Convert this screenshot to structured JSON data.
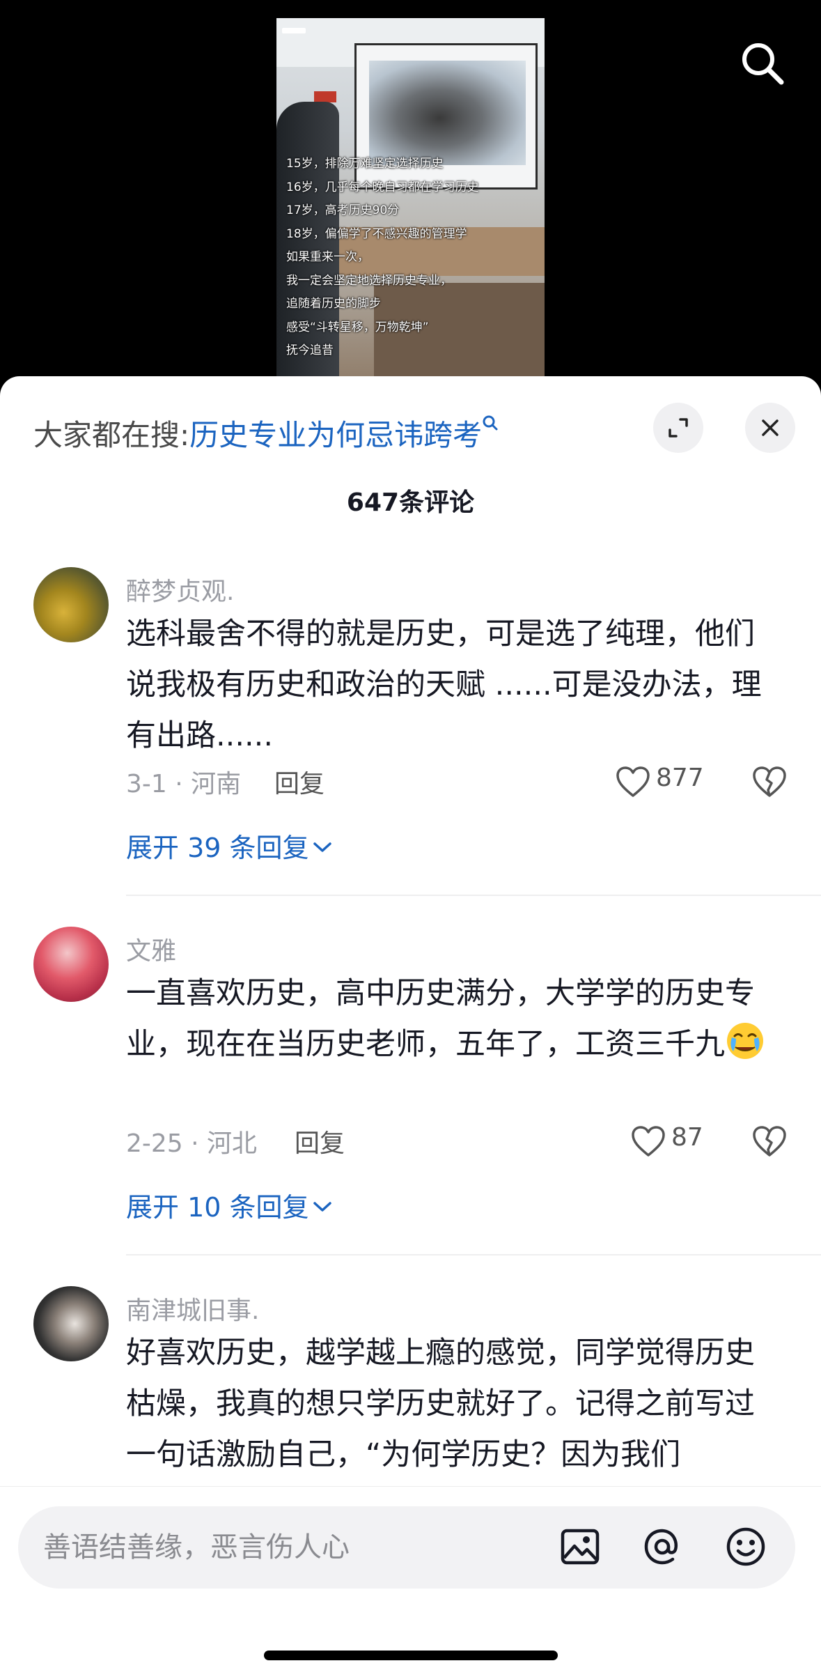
{
  "video": {
    "subtitles": [
      "15岁，排除万难坚定选择历史",
      "16岁，几乎每个晚自习都在学习历史",
      "17岁，高考历史90分",
      "18岁，偏偏学了不感兴趣的管理学",
      "如果重来一次，",
      "我一定会坚定地选择历史专业，",
      "追随着历史的脚步",
      "感受“斗转星移，万物乾坤”",
      "抚今追昔"
    ]
  },
  "hot_search": {
    "prefix": "大家都在搜:",
    "keyword": "历史专业为何忌讳跨考",
    "icon": "search-small-icon"
  },
  "comments_count": "647条评论",
  "comments": [
    {
      "username": "醉梦贞观.",
      "text": "选科最舍不得的就是历史，可是选了纯理，他们说我极有历史和政治的天赋 ......可是没办法，理有出路......",
      "date_location": "3-1 · 河南",
      "reply_label": "回复",
      "likes": "877",
      "expand_label": "展开 39 条回复"
    },
    {
      "username": "文雅",
      "text": "一直喜欢历史，高中历史满分，大学学的历史专业，现在在当历史老师，五年了，工资三千九",
      "emoji": "crying-face-emoji",
      "date_location": "2-25 · 河北",
      "reply_label": "回复",
      "likes": "87",
      "expand_label": "展开 10 条回复"
    },
    {
      "username": "南津城旧事.",
      "text": "好喜欢历史，越学越上瘾的感觉，同学觉得历史枯燥，我真的想只学历史就好了。记得之前写过一句话激励自己，“为何学历史？因为我们"
    }
  ],
  "input": {
    "placeholder": "善语结善缘，恶言伤人心"
  },
  "colors": {
    "link_blue": "#1b64c0",
    "meta_gray": "#9a9ca3",
    "text_dark": "#161823"
  }
}
